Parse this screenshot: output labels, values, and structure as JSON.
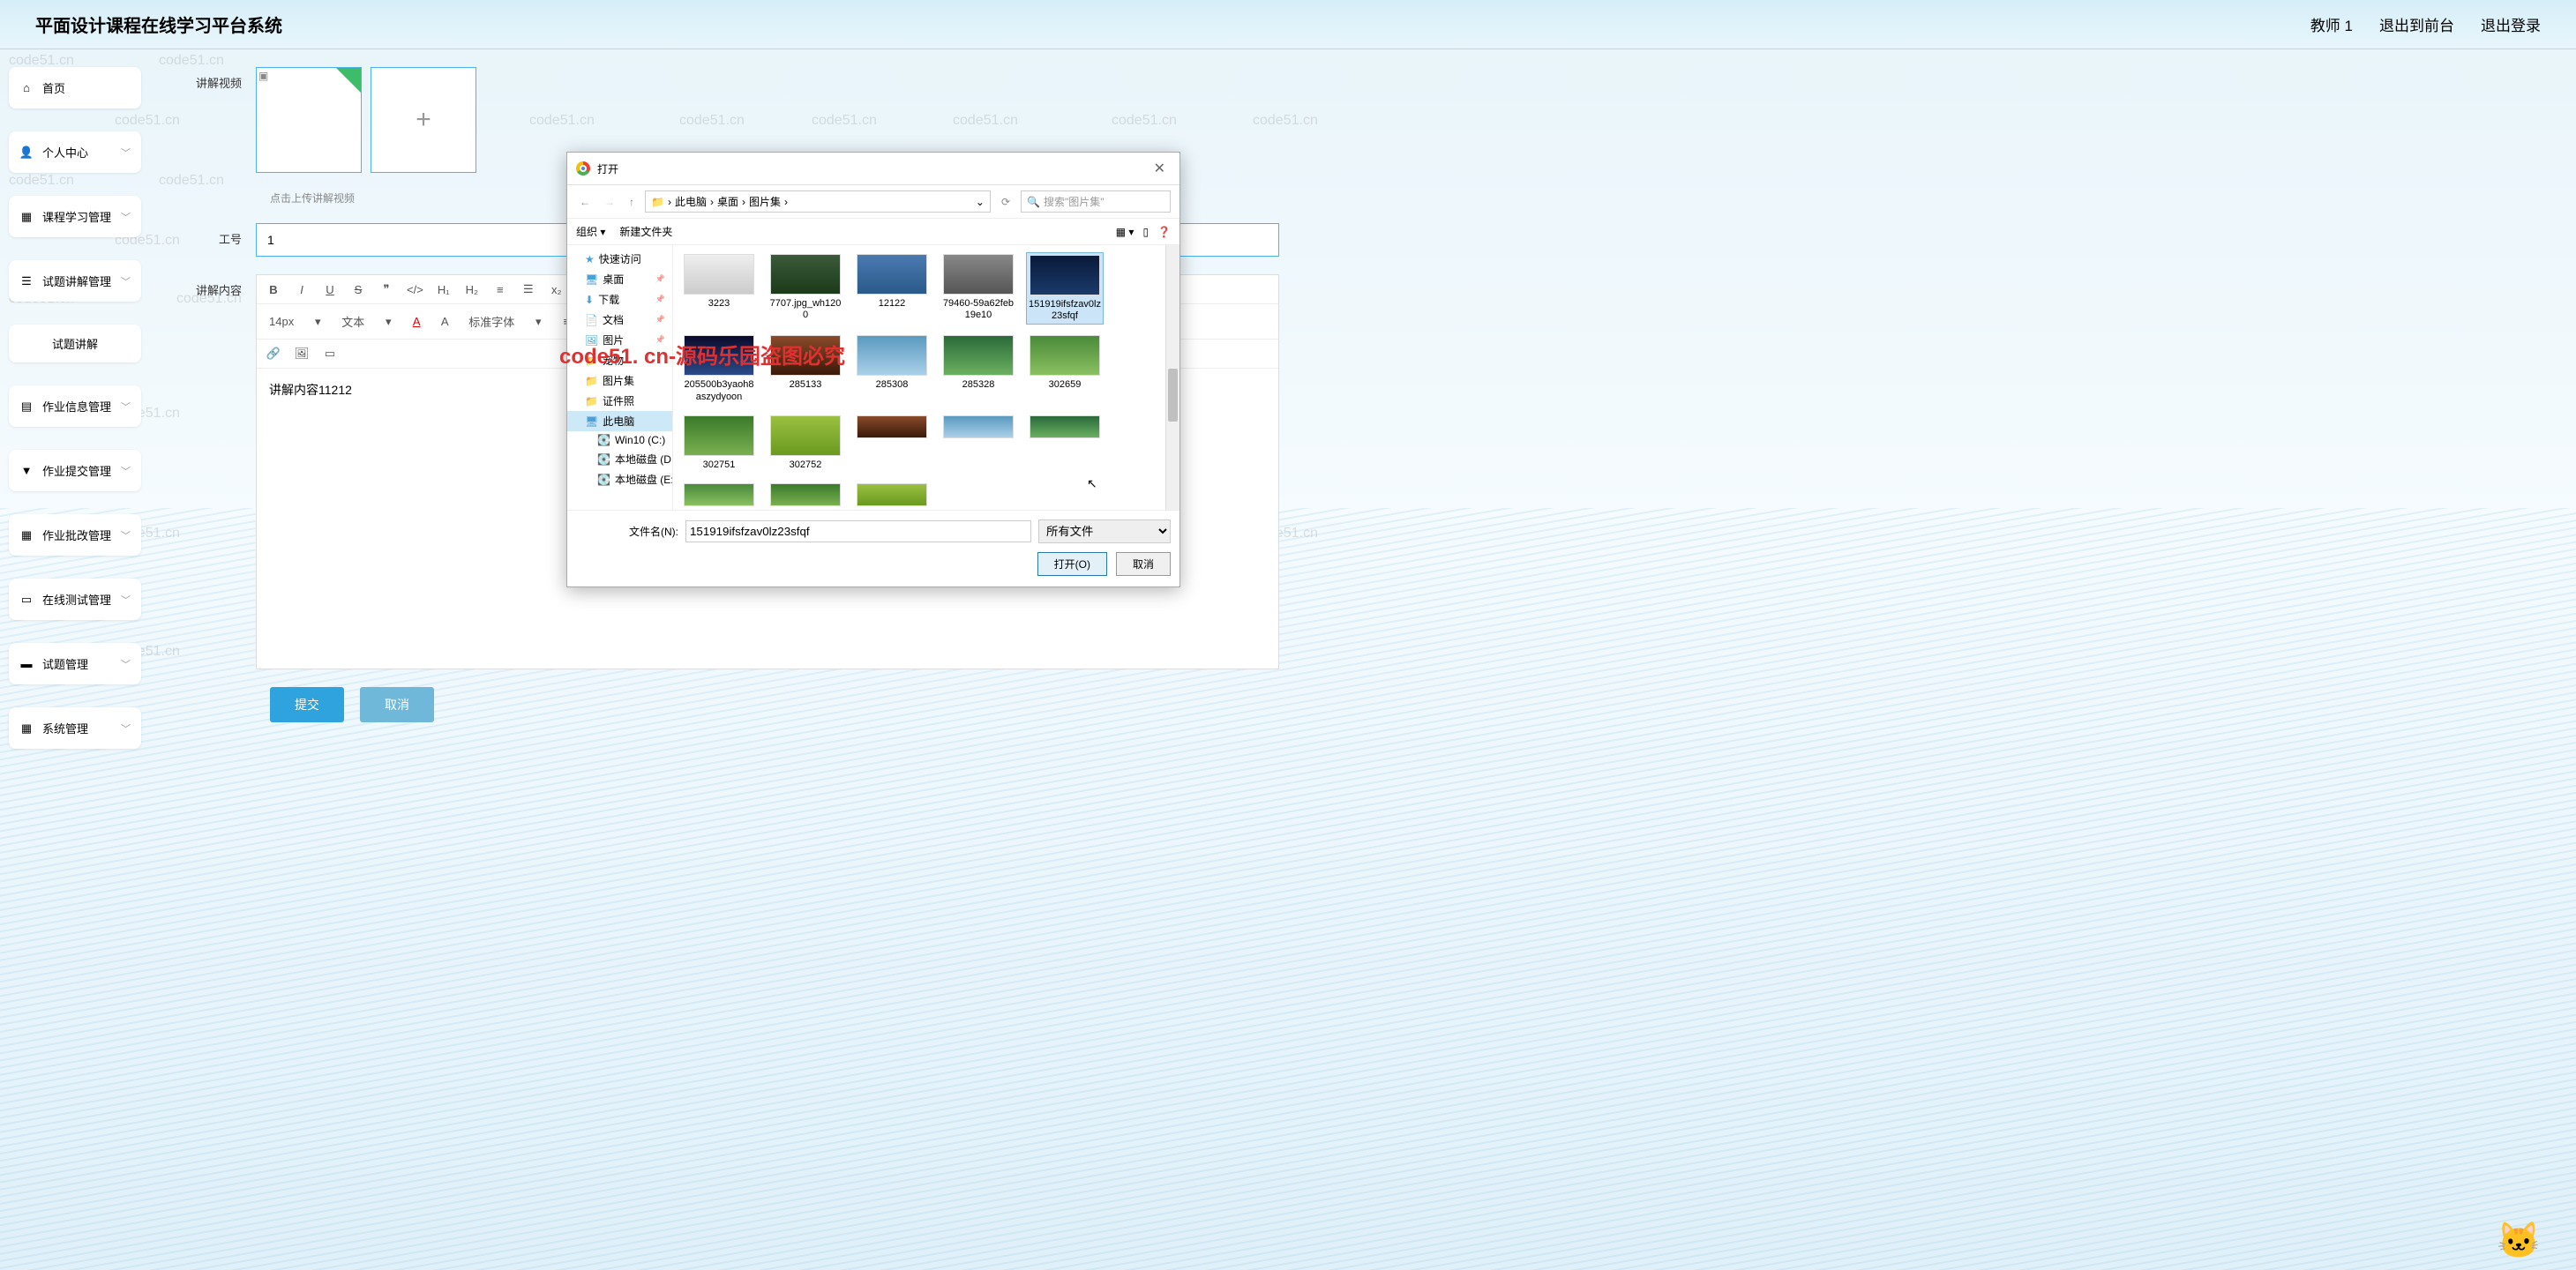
{
  "header": {
    "title": "平面设计课程在线学习平台系统",
    "user": "教师 1",
    "front_link": "退出到前台",
    "logout": "退出登录"
  },
  "sidebar": {
    "items": [
      {
        "label": "首页",
        "icon": "home"
      },
      {
        "label": "个人中心",
        "icon": "user"
      },
      {
        "label": "课程学习管理",
        "icon": "grid"
      },
      {
        "label": "试题讲解管理",
        "icon": "list"
      },
      {
        "label": "试题讲解",
        "icon": ""
      },
      {
        "label": "作业信息管理",
        "icon": "doc"
      },
      {
        "label": "作业提交管理",
        "icon": "upload"
      },
      {
        "label": "作业批改管理",
        "icon": "check"
      },
      {
        "label": "在线测试管理",
        "icon": "test"
      },
      {
        "label": "试题管理",
        "icon": "question"
      },
      {
        "label": "系统管理",
        "icon": "gear"
      }
    ]
  },
  "form": {
    "video_label": "讲解视频",
    "video_hint": "点击上传讲解视频",
    "id_label": "工号",
    "id_value": "1",
    "content_label": "讲解内容",
    "content_value": "讲解内容11212",
    "submit": "提交",
    "cancel": "取消"
  },
  "editor_toolbar": {
    "fontsize": "14px",
    "format": "文本",
    "fontfamily": "标准字体"
  },
  "dialog": {
    "title": "打开",
    "crumbs": [
      "此电脑",
      "桌面",
      "图片集"
    ],
    "search_placeholder": "搜索\"图片集\"",
    "organize": "组织",
    "new_folder": "新建文件夹",
    "tree": [
      {
        "label": "快速访问",
        "icon": "star"
      },
      {
        "label": "桌面",
        "icon": "desktop",
        "pinned": true
      },
      {
        "label": "下载",
        "icon": "download",
        "pinned": true
      },
      {
        "label": "文档",
        "icon": "doc",
        "pinned": true
      },
      {
        "label": "图片",
        "icon": "image",
        "pinned": true
      },
      {
        "label": "宠物",
        "icon": "folder"
      },
      {
        "label": "图片集",
        "icon": "folder"
      },
      {
        "label": "证件照",
        "icon": "folder"
      },
      {
        "label": "此电脑",
        "icon": "pc",
        "selected": true
      },
      {
        "label": "Win10 (C:)",
        "icon": "disk",
        "indent": true
      },
      {
        "label": "本地磁盘 (D:)",
        "icon": "disk",
        "indent": true
      },
      {
        "label": "本地磁盘 (E:)",
        "icon": "disk",
        "indent": true
      }
    ],
    "files": [
      {
        "name": "3223",
        "t": "t1"
      },
      {
        "name": "7707.jpg_wh1200",
        "t": "t2"
      },
      {
        "name": "12122",
        "t": "t3"
      },
      {
        "name": "79460-59a62feb19e10",
        "t": "t4"
      },
      {
        "name": "151919ifsfzav0lz23sfqf",
        "t": "t5",
        "selected": true
      },
      {
        "name": "205500b3yaoh8aszydyoon",
        "t": "t6"
      },
      {
        "name": "285133",
        "t": "t7"
      },
      {
        "name": "285308",
        "t": "t8"
      },
      {
        "name": "285328",
        "t": "t9"
      },
      {
        "name": "302659",
        "t": "t10"
      },
      {
        "name": "302751",
        "t": "t11"
      },
      {
        "name": "302752",
        "t": "t12"
      }
    ],
    "filename_label": "文件名(N):",
    "filename_value": "151919ifsfzav0lz23sfqf",
    "filter": "所有文件",
    "open_btn": "打开(O)",
    "cancel_btn": "取消"
  },
  "overlay_text": "code51. cn-源码乐园盗图必究",
  "watermark": "code51.cn"
}
